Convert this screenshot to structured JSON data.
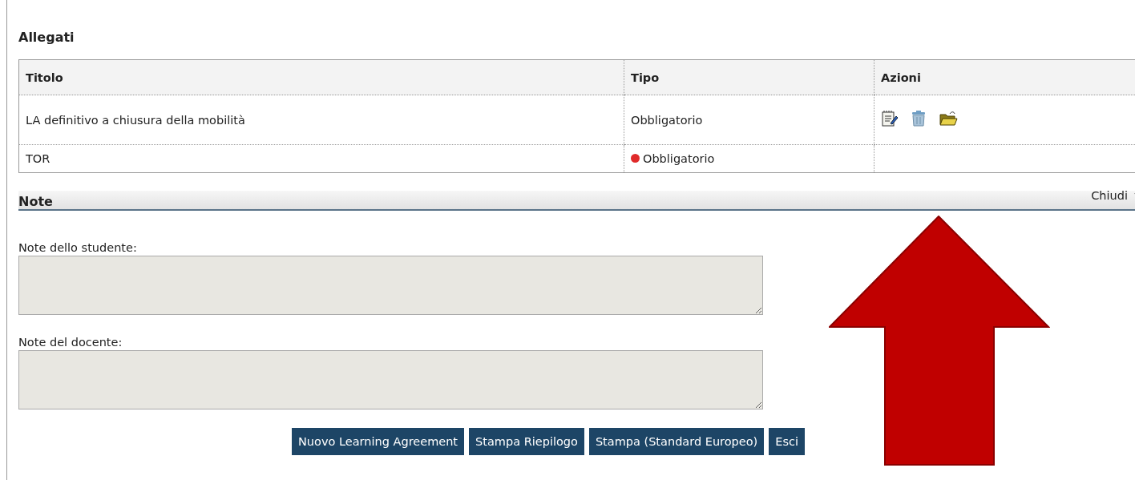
{
  "attachments": {
    "title": "Allegati",
    "columns": [
      "Titolo",
      "Tipo",
      "Azioni"
    ],
    "rows": [
      {
        "title": "LA definitivo a chiusura della mobilità",
        "type": "Obbligatorio",
        "missing": false,
        "actions": [
          {
            "kind": "edit"
          },
          {
            "kind": "delete"
          },
          {
            "kind": "open"
          }
        ]
      },
      {
        "title": "TOR",
        "type": "Obbligatorio",
        "missing": true
      }
    ]
  },
  "notes": {
    "title": "Note",
    "toggle": "Chiudi",
    "fields": [
      {
        "label": "Note dello studente:"
      },
      {
        "label": "Note del docente:"
      }
    ]
  },
  "buttons": [
    "Nuovo Learning Agreement",
    "Stampa Riepilogo",
    "Stampa (Standard Europeo)",
    "Esci"
  ]
}
